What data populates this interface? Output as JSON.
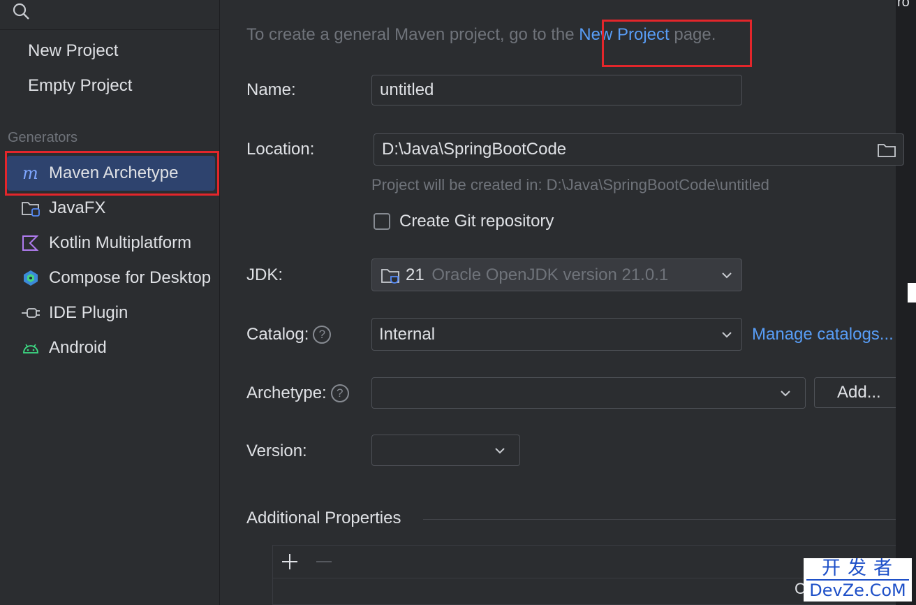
{
  "sidebar": {
    "items": [
      {
        "label": "New Project"
      },
      {
        "label": "Empty Project"
      }
    ],
    "group_label": "Generators",
    "generators": [
      {
        "label": "Maven Archetype",
        "icon": "maven-icon"
      },
      {
        "label": "JavaFX",
        "icon": "javafx-folder-icon"
      },
      {
        "label": "Kotlin Multiplatform",
        "icon": "kotlin-icon"
      },
      {
        "label": "Compose for Desktop",
        "icon": "compose-icon"
      },
      {
        "label": "IDE Plugin",
        "icon": "plugin-icon"
      },
      {
        "label": "Android",
        "icon": "android-icon"
      }
    ]
  },
  "main": {
    "info_prefix": "To create a general Maven project, go to the ",
    "info_link": "New Project",
    "info_suffix": " page.",
    "name_label": "Name:",
    "name_value": "untitled",
    "location_label": "Location:",
    "location_value": "D:\\Java\\SpringBootCode",
    "location_hint": "Project will be created in: D:\\Java\\SpringBootCode\\untitled",
    "git_label": "Create Git repository",
    "jdk_label": "JDK:",
    "jdk_number": "21",
    "jdk_name": "Oracle OpenJDK version 21.0.1",
    "catalog_label": "Catalog:",
    "catalog_value": "Internal",
    "manage_link": "Manage catalogs...",
    "archetype_label": "Archetype:",
    "archetype_value": "",
    "add_button": "Add...",
    "version_label": "Version:",
    "version_value": "",
    "additional_label": "Additional Properties",
    "help_glyph": "?"
  },
  "watermark": {
    "cn": "开发者",
    "en": "DevZe.CoM"
  },
  "colors": {
    "accent": "#589df6",
    "selection": "#2e436e",
    "highlight": "#e3262b",
    "background": "#2b2d30"
  }
}
